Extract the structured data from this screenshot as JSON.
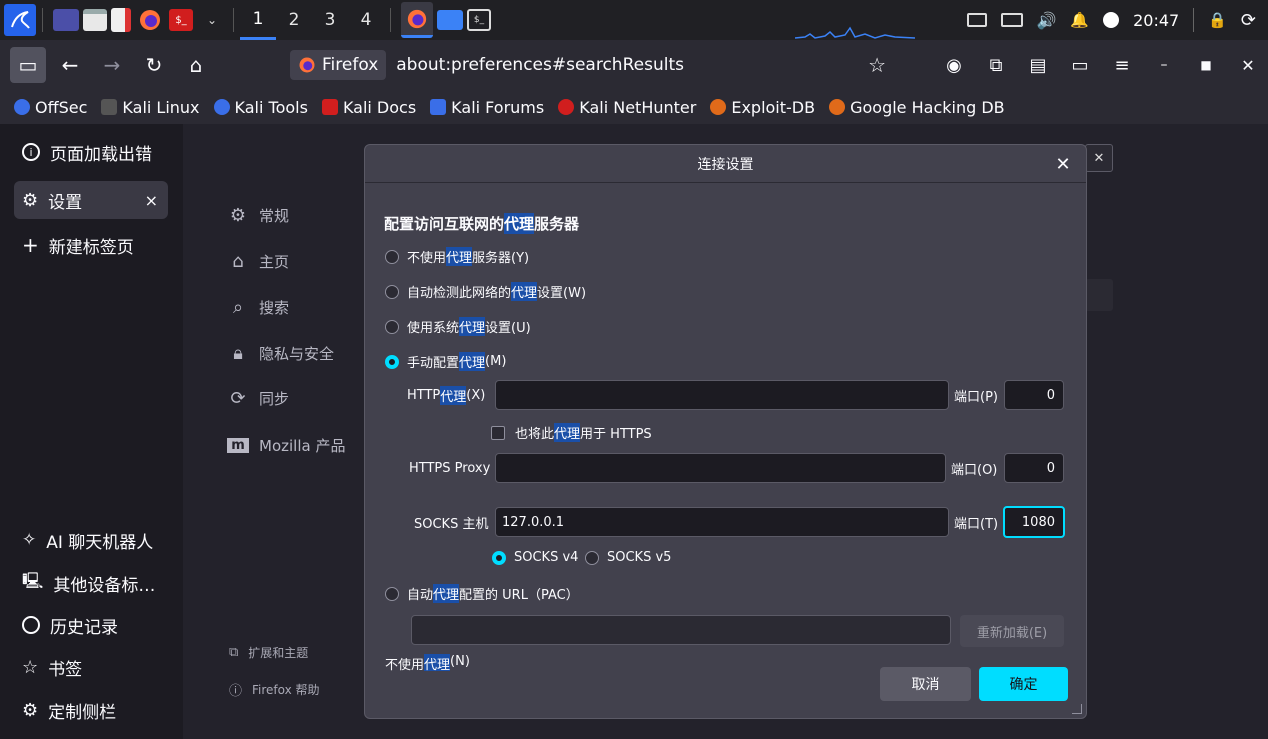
{
  "taskbar": {
    "workspaces": [
      "1",
      "2",
      "3",
      "4"
    ],
    "active_workspace": "1",
    "clock": "20:47"
  },
  "navbar": {
    "identity_label": "Firefox",
    "url": "about:preferences#searchResults"
  },
  "bookmarks": [
    {
      "label": "OffSec",
      "color": "#3a6ee8"
    },
    {
      "label": "Kali Linux",
      "color": "#2b2a33"
    },
    {
      "label": "Kali Tools",
      "color": "#3a6ee8"
    },
    {
      "label": "Kali Docs",
      "color": "#d11e1e"
    },
    {
      "label": "Kali Forums",
      "color": "#3a6ee8"
    },
    {
      "label": "Kali NetHunter",
      "color": "#d11e1e"
    },
    {
      "label": "Exploit-DB",
      "color": "#e06a1a"
    },
    {
      "label": "Google Hacking DB",
      "color": "#e06a1a"
    }
  ],
  "sidebar": {
    "items": [
      {
        "label": "页面加载出错",
        "icon": "info-icon"
      },
      {
        "label": "设置",
        "icon": "gear-icon",
        "close": "×"
      },
      {
        "label": "新建标签页",
        "icon": "plus-icon"
      },
      {
        "label": "AI 聊天机器人",
        "icon": "sparkle-icon"
      },
      {
        "label": "其他设备标…",
        "icon": "devices-icon"
      },
      {
        "label": "历史记录",
        "icon": "clock-icon"
      },
      {
        "label": "书签",
        "icon": "star-icon"
      },
      {
        "label": "定制侧栏",
        "icon": "gear-icon"
      }
    ]
  },
  "prefs": {
    "nav": [
      {
        "label": "常规",
        "icon": "gear-icon"
      },
      {
        "label": "主页",
        "icon": "home-icon"
      },
      {
        "label": "搜索",
        "icon": "search-icon"
      },
      {
        "label": "隐私与安全",
        "icon": "lock-icon"
      },
      {
        "label": "同步",
        "icon": "sync-icon"
      },
      {
        "label": "Mozilla 产品",
        "icon": "mozilla-icon"
      }
    ],
    "footer": [
      {
        "label": "扩展和主题",
        "icon": "puzzle-icon"
      },
      {
        "label": "Firefox 帮助",
        "icon": "help-icon"
      }
    ]
  },
  "dialog": {
    "title": "连接设置",
    "heading_pre": "配置访问互联网的",
    "heading_hl": "代理",
    "heading_post": "服务器",
    "options": {
      "no_proxy": {
        "pre": "不使用",
        "hl": "代理",
        "post": "服务器(Y)"
      },
      "auto_detect": {
        "pre": "自动检测此网络的",
        "hl": "代理",
        "post": "设置(W)"
      },
      "system": {
        "pre": "使用系统",
        "hl": "代理",
        "post": "设置(U)"
      },
      "manual": {
        "pre": "手动配置",
        "hl": "代理",
        "post": "(M)"
      },
      "pac": {
        "pre": "自动",
        "hl": "代理",
        "post": "配置的 URL（PAC）"
      }
    },
    "selected": "manual",
    "http": {
      "label_pre": "HTTP ",
      "label_hl": "代理",
      "label_post": "(X)",
      "value": "",
      "port_label": "端口(P)",
      "port": "0"
    },
    "also_https": {
      "pre": "也将此",
      "hl": "代理",
      "post": "用于 HTTPS",
      "checked": false
    },
    "https": {
      "label": "HTTPS Proxy",
      "value": "",
      "port_label": "端口(O)",
      "port": "0"
    },
    "socks": {
      "label": "SOCKS 主机",
      "value": "127.0.0.1",
      "port_label": "端口(T)",
      "port": "1080"
    },
    "socks_versions": [
      {
        "label": "SOCKS v4",
        "selected": true
      },
      {
        "label": "SOCKS v5",
        "selected": false
      }
    ],
    "pac_url": "",
    "reload_button": "重新加载(E)",
    "no_proxy_for": {
      "pre": "不使用",
      "hl": "代理",
      "post": "(N)"
    },
    "cancel": "取消",
    "ok": "确定"
  },
  "colors": {
    "accent": "#00ddff",
    "highlight": "#1a4fa8",
    "dialog_bg": "#42414d"
  }
}
